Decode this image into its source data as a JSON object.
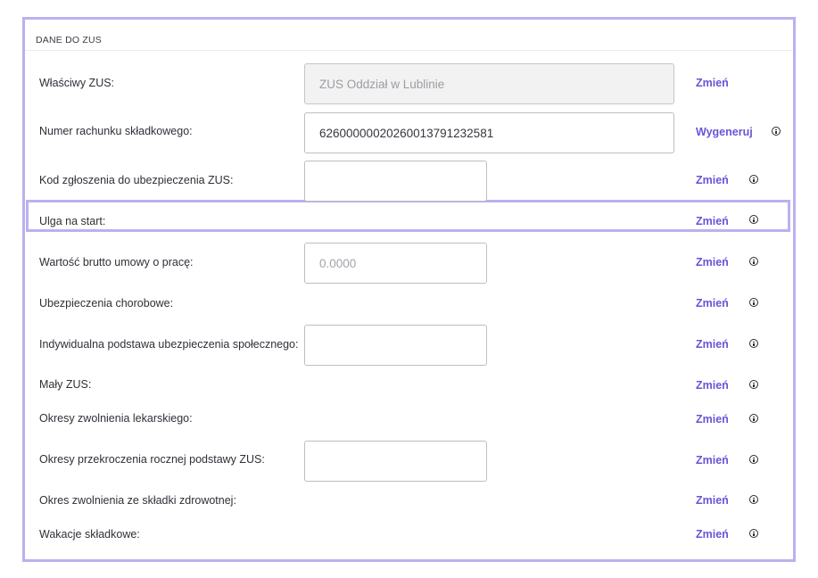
{
  "section": {
    "title": "DANE DO ZUS"
  },
  "rows": [
    {
      "label": "Właściwy ZUS:",
      "action": "Zmień",
      "field_value": "ZUS Oddział w Lublinie"
    },
    {
      "label": "Numer rachunku składkowego:",
      "action": "Wygeneruj",
      "field_value": "62600000020260013791232581"
    },
    {
      "label": "Kod zgłoszenia do ubezpieczenia ZUS:",
      "action": "Zmień",
      "field_value": ""
    },
    {
      "label": "Ulga na start:",
      "action": "Zmień"
    },
    {
      "label": "Wartość brutto umowy o pracę:",
      "action": "Zmień",
      "field_value": "0.0000"
    },
    {
      "label": "Ubezpieczenia chorobowe:",
      "action": "Zmień"
    },
    {
      "label": "Indywidualna podstawa ubezpieczenia społecznego:",
      "action": "Zmień",
      "field_value": ""
    },
    {
      "label": "Mały ZUS:",
      "action": "Zmień"
    },
    {
      "label": "Okresy zwolnienia lekarskiego:",
      "action": "Zmień"
    },
    {
      "label": "Okresy przekroczenia rocznej podstawy ZUS:",
      "action": "Zmień",
      "field_value": ""
    },
    {
      "label": "Okres zwolnienia ze składki zdrowotnej:",
      "action": "Zmień"
    },
    {
      "label": "Wakacje składkowe:",
      "action": "Zmień"
    }
  ],
  "icons": {
    "info": "info-circle-icon"
  },
  "colors": {
    "accent": "#6a54d6",
    "highlight_border": "#bcb0ef"
  }
}
